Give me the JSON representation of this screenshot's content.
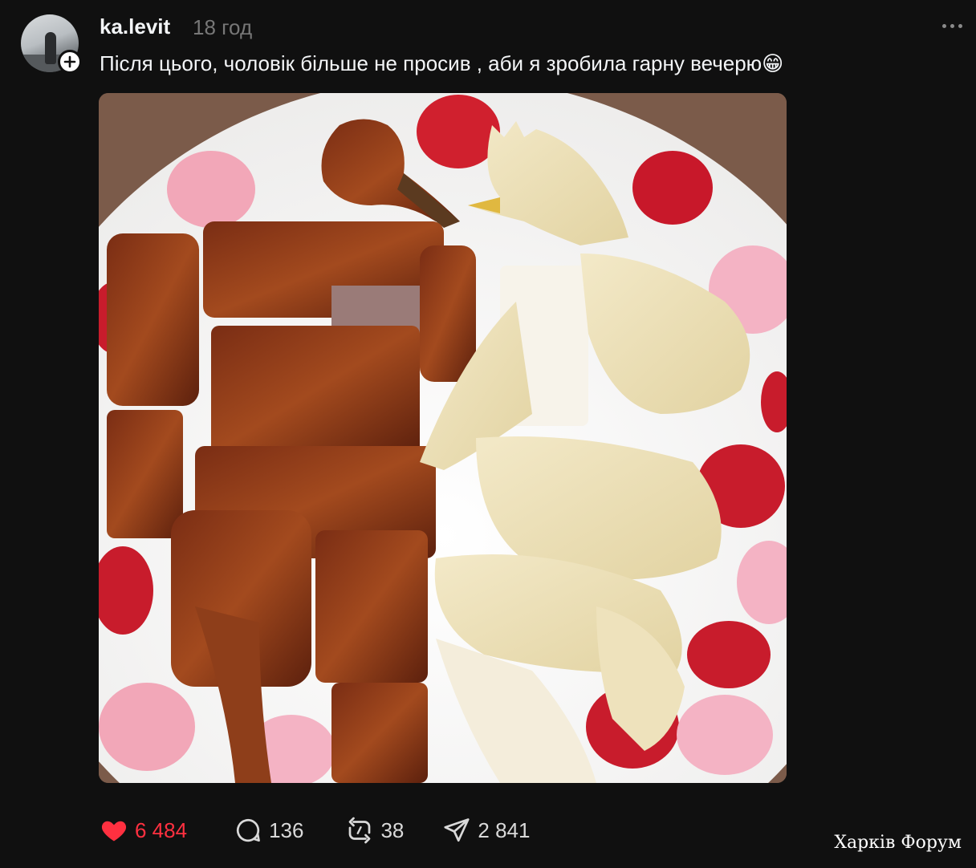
{
  "post": {
    "username": "ka.levit",
    "timestamp": "18 год",
    "text": "Після цього, чоловік більше не просив , аби я зробила гарну вечерю😁",
    "image_icon": "photo of roast duck and boiled chicken arranged on plate with rose petals"
  },
  "actions": {
    "likes": "6 484",
    "comments": "136",
    "reposts": "38",
    "shares": "2 841"
  },
  "colors": {
    "background": "#101010",
    "like": "#ff3040",
    "text": "#f3f5f7",
    "muted": "#777777"
  },
  "watermark": "Харків Форум"
}
